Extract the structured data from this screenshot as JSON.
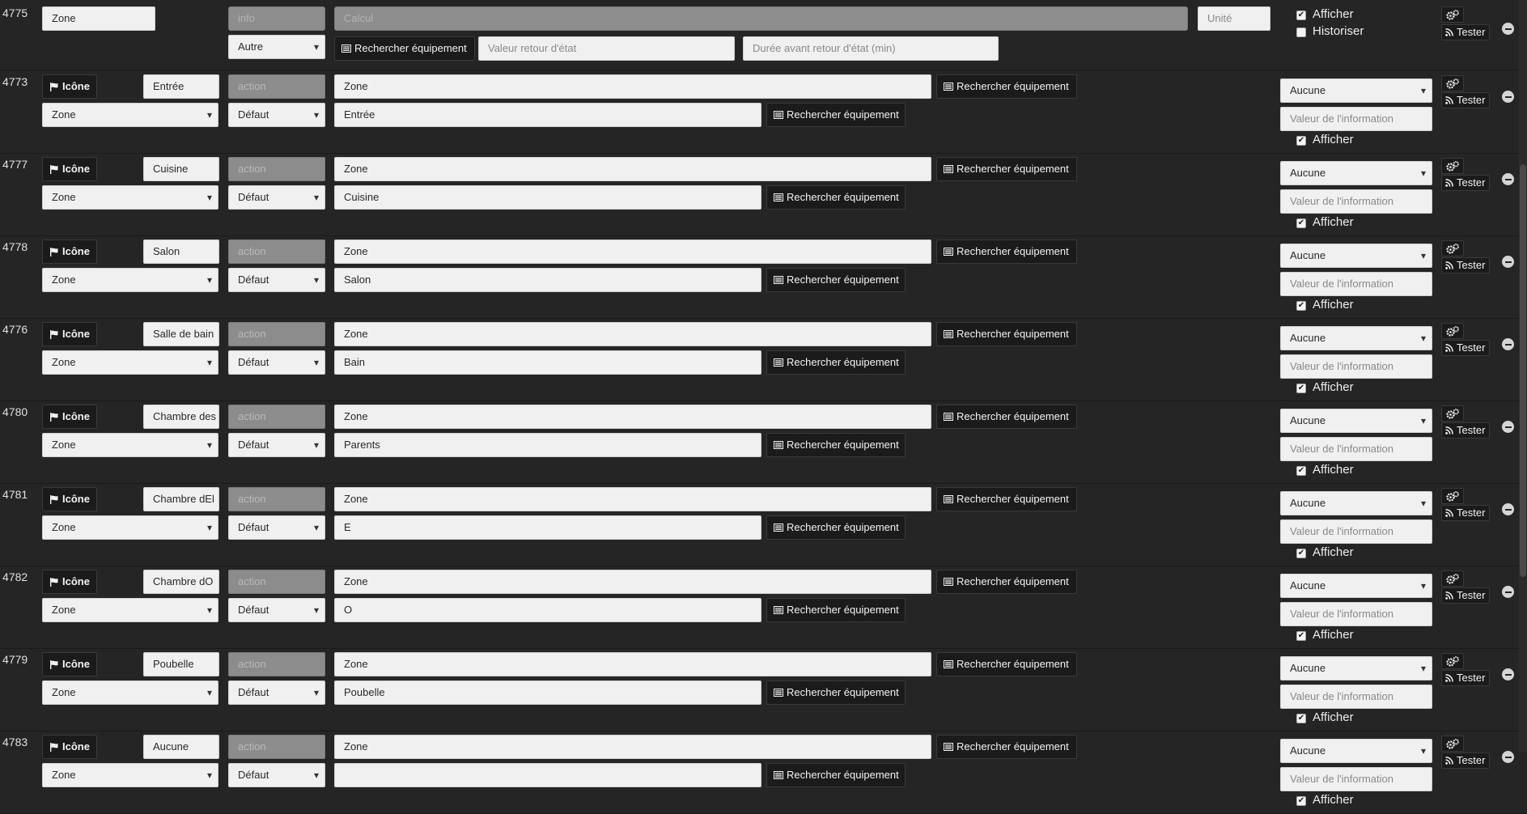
{
  "labels": {
    "icon_button": "Icône",
    "search_equipment": "Rechercher équipement",
    "test_button": "Tester",
    "show": "Afficher",
    "historize": "Historiser"
  },
  "first_row": {
    "id": "4775",
    "name": "Zone",
    "type": "info",
    "subtype": "Autre",
    "calcul_placeholder": "Calcul",
    "unit_placeholder": "Unité",
    "return_state_value_placeholder": "Valeur retour d'état",
    "return_state_delay_placeholder": "Durée avant retour d'état (min)",
    "afficher_checked": true,
    "historiser_checked": false
  },
  "rows": [
    {
      "id": "4773",
      "name": "Entrée",
      "generic": "Zone",
      "type": "action",
      "subtype": "Défaut",
      "command": "Zone",
      "value": "Entrée",
      "update": "Aucune",
      "info_placeholder": "Valeur de l'information",
      "afficher_checked": true
    },
    {
      "id": "4777",
      "name": "Cuisine",
      "generic": "Zone",
      "type": "action",
      "subtype": "Défaut",
      "command": "Zone",
      "value": "Cuisine",
      "update": "Aucune",
      "info_placeholder": "Valeur de l'information",
      "afficher_checked": true
    },
    {
      "id": "4778",
      "name": "Salon",
      "generic": "Zone",
      "type": "action",
      "subtype": "Défaut",
      "command": "Zone",
      "value": "Salon",
      "update": "Aucune",
      "info_placeholder": "Valeur de l'information",
      "afficher_checked": true
    },
    {
      "id": "4776",
      "name": "Salle de bain",
      "generic": "Zone",
      "type": "action",
      "subtype": "Défaut",
      "command": "Zone",
      "value": "Bain",
      "update": "Aucune",
      "info_placeholder": "Valeur de l'information",
      "afficher_checked": true
    },
    {
      "id": "4780",
      "name": "Chambre des",
      "generic": "Zone",
      "type": "action",
      "subtype": "Défaut",
      "command": "Zone",
      "value": "Parents",
      "update": "Aucune",
      "info_placeholder": "Valeur de l'information",
      "afficher_checked": true
    },
    {
      "id": "4781",
      "name": "Chambre dEl",
      "generic": "Zone",
      "type": "action",
      "subtype": "Défaut",
      "command": "Zone",
      "value": "E",
      "update": "Aucune",
      "info_placeholder": "Valeur de l'information",
      "afficher_checked": true
    },
    {
      "id": "4782",
      "name": "Chambre dO",
      "generic": "Zone",
      "type": "action",
      "subtype": "Défaut",
      "command": "Zone",
      "value": "O",
      "update": "Aucune",
      "info_placeholder": "Valeur de l'information",
      "afficher_checked": true
    },
    {
      "id": "4779",
      "name": "Poubelle",
      "generic": "Zone",
      "type": "action",
      "subtype": "Défaut",
      "command": "Zone",
      "value": "Poubelle",
      "update": "Aucune",
      "info_placeholder": "Valeur de l'information",
      "afficher_checked": true
    },
    {
      "id": "4783",
      "name": "Aucune",
      "generic": "Zone",
      "type": "action",
      "subtype": "Défaut",
      "command": "Zone",
      "value": "",
      "update": "Aucune",
      "info_placeholder": "Valeur de l'information",
      "afficher_checked": true
    }
  ],
  "icons": {
    "flag": "flag-icon",
    "equipment": "list-icon",
    "config": "cogs-icon",
    "test": "rss-icon",
    "remove": "minus-circle-icon"
  }
}
